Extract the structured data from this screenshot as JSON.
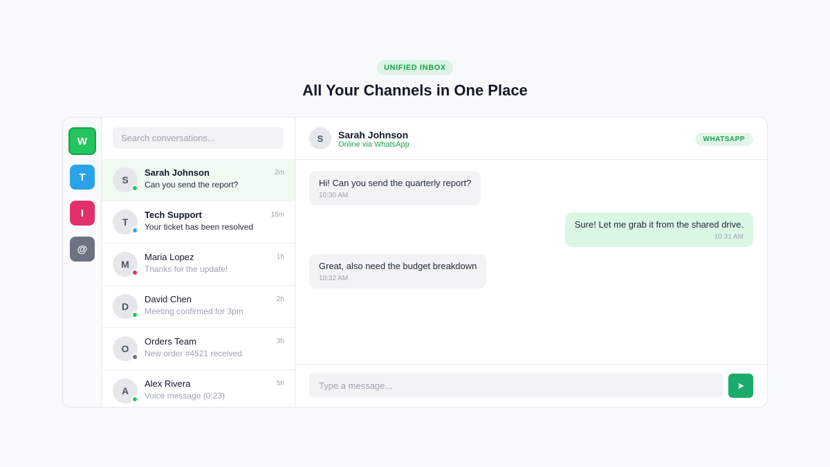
{
  "hero": {
    "eyebrow": "UNIFIED INBOX",
    "title": "All Your Channels in One Place"
  },
  "channels": [
    {
      "letter": "W",
      "name": "whatsapp",
      "color": "#22c55e",
      "active": true
    },
    {
      "letter": "T",
      "name": "telegram",
      "color": "#2aa3ea",
      "active": false
    },
    {
      "letter": "I",
      "name": "instagram",
      "color": "#e1306c",
      "active": false
    },
    {
      "letter": "@",
      "name": "email",
      "color": "#6b7280",
      "active": false
    }
  ],
  "search": {
    "placeholder": "Search conversations..."
  },
  "conversations": [
    {
      "initial": "S",
      "name": "Sarah Johnson",
      "time": "2m",
      "preview": "Can you send the report?",
      "unread": true,
      "selected": true,
      "dot": "#22c55e"
    },
    {
      "initial": "T",
      "name": "Tech Support",
      "time": "15m",
      "preview": "Your ticket has been resolved",
      "unread": true,
      "selected": false,
      "dot": "#2aa3ea"
    },
    {
      "initial": "M",
      "name": "Maria Lopez",
      "time": "1h",
      "preview": "Thanks for the update!",
      "unread": false,
      "selected": false,
      "dot": "#e1306c"
    },
    {
      "initial": "D",
      "name": "David Chen",
      "time": "2h",
      "preview": "Meeting confirmed for 3pm",
      "unread": false,
      "selected": false,
      "dot": "#22c55e"
    },
    {
      "initial": "O",
      "name": "Orders Team",
      "time": "3h",
      "preview": "New order #4521 received",
      "unread": false,
      "selected": false,
      "dot": "#6b7280"
    },
    {
      "initial": "A",
      "name": "Alex Rivera",
      "time": "5h",
      "preview": "Voice message (0:23)",
      "unread": false,
      "selected": false,
      "dot": "#22c55e"
    }
  ],
  "chat": {
    "initial": "S",
    "name": "Sarah Johnson",
    "status": "Online via WhatsApp",
    "badge": "WHATSAPP",
    "messages": [
      {
        "direction": "in",
        "text": "Hi! Can you send the quarterly report?",
        "time": "10:30 AM"
      },
      {
        "direction": "out",
        "text": "Sure! Let me grab it from the shared drive.",
        "time": "10:31 AM"
      },
      {
        "direction": "in",
        "text": "Great, also need the budget breakdown",
        "time": "10:32 AM"
      }
    ]
  },
  "composer": {
    "placeholder": "Type a message...",
    "send_icon": "➤"
  },
  "colors": {
    "accent": "#16a34a",
    "send": "#1bab6b"
  }
}
